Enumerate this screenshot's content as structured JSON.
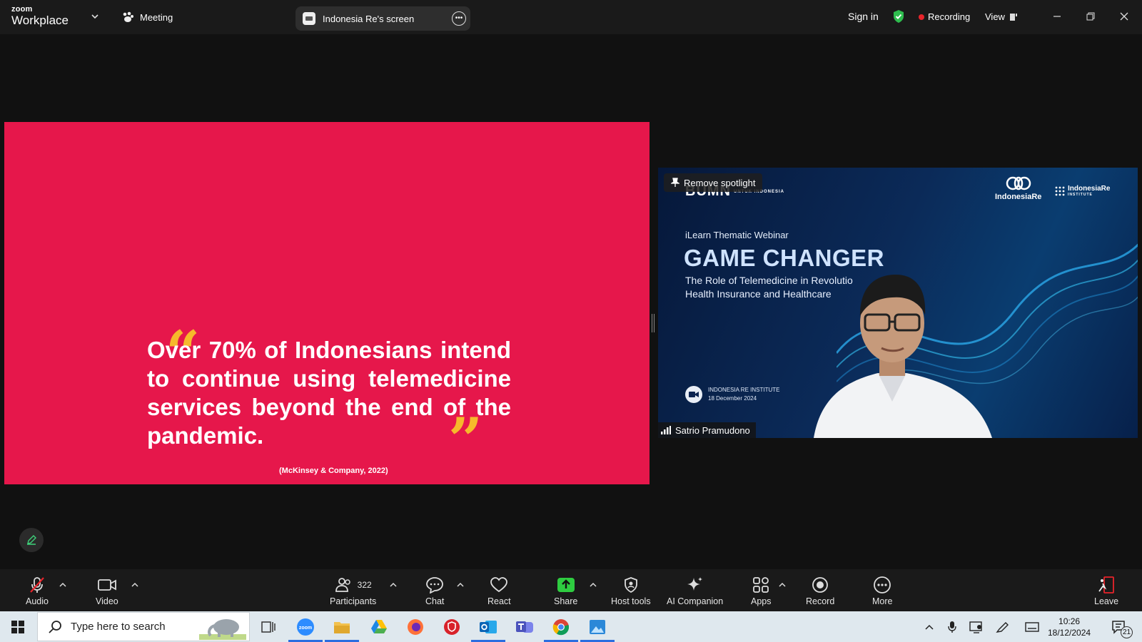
{
  "titlebar": {
    "brand_small": "zoom",
    "brand_large": "Workplace",
    "meeting_label": "Meeting",
    "share_label": "Indonesia Re's screen",
    "signin_label": "Sign in",
    "recording_label": "Recording",
    "view_label": "View"
  },
  "slide": {
    "quote": "Over 70% of Indonesians intend to continue using telemedicine services beyond the end of the pandemic.",
    "source": "(McKinsey & Company, 2022)"
  },
  "video": {
    "spotlight_label": "Remove spotlight",
    "bumn_text": "BUMN",
    "bumn_small": "UNTUK INDONESIA",
    "logo1_text": "IndonesiaRe",
    "logo2_text": "IndonesiaRe",
    "logo2_sub": "INSTITUTE",
    "ilearn": "iLearn Thematic Webinar",
    "title": "GAME CHANGER",
    "sub1": "The Role of Telemedicine in Revolutio",
    "sub2": "Health Insurance and Healthcare",
    "institute": "INDONESIA RE INSTITUTE",
    "date": "18 December 2024",
    "participant_name": "Satrio Pramudono"
  },
  "toolbar": {
    "audio": "Audio",
    "video": "Video",
    "participants": "Participants",
    "participants_count": "322",
    "chat": "Chat",
    "react": "React",
    "share": "Share",
    "host_tools": "Host tools",
    "ai_companion": "AI Companion",
    "apps": "Apps",
    "record": "Record",
    "more": "More",
    "leave": "Leave"
  },
  "taskbar": {
    "search_placeholder": "Type here to search",
    "time": "10:26",
    "date": "18/12/2024",
    "notifications": "21"
  },
  "colors": {
    "slide_bg": "#e6174b",
    "quote_mark": "#f6b92b",
    "recording_dot": "#e8242b",
    "share_green": "#2ecc40",
    "shield_green": "#2ebd4e"
  }
}
